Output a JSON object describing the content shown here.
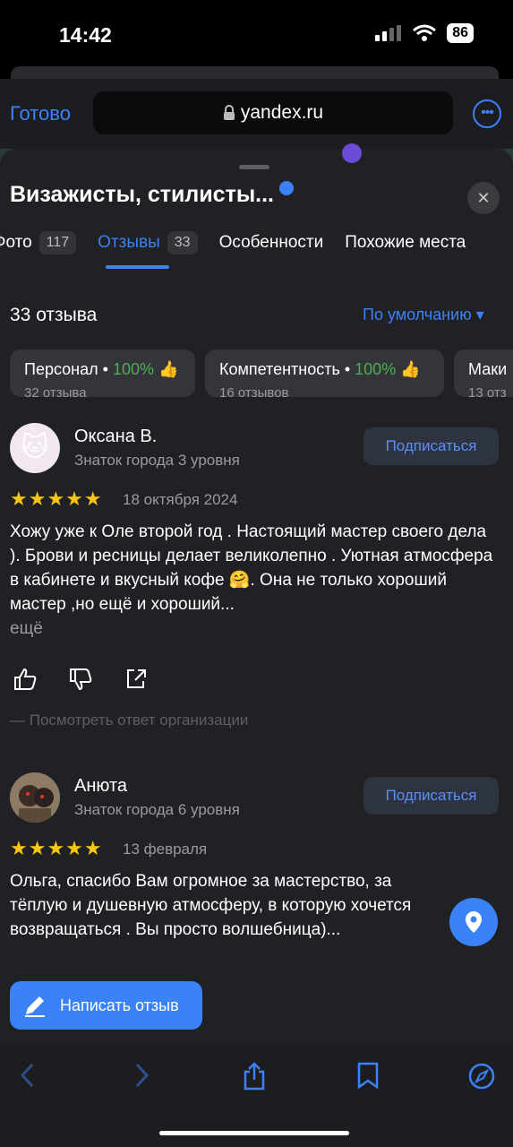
{
  "status": {
    "time": "14:42",
    "battery": "86"
  },
  "browser": {
    "done_label": "Готово",
    "url": "yandex.ru"
  },
  "header": {
    "title": "Визажисты, стилисты..."
  },
  "tabs": [
    {
      "label": "Фото",
      "count": "117"
    },
    {
      "label": "Отзывы",
      "count": "33"
    },
    {
      "label": "Особенности"
    },
    {
      "label": "Похожие места"
    }
  ],
  "summary": {
    "count_label": "33 отзыва",
    "sort_label": "По умолчанию ▾"
  },
  "chips": [
    {
      "label": "Персонал",
      "percent": "100%",
      "sub": "32 отзыва"
    },
    {
      "label": "Компетентность",
      "percent": "100%",
      "sub": "16 отзывов"
    },
    {
      "label": "Маки",
      "sub": "13 отз"
    }
  ],
  "reviews": [
    {
      "author": "Оксана В.",
      "level": "Знаток города 3 уровня",
      "subscribe": "Подписаться",
      "stars": "★★★★★",
      "date": "18 октября 2024",
      "text": "Хожу уже к Оле второй год . Настоящий мастер своего дела ). Брови и ресницы делает великолепно . Уютная атмосфера в кабинете и вкусный кофе 🤗. Она не только хороший мастер ,но ещё и хороший...",
      "more": "ещё",
      "org_reply": "— Посмотреть ответ организации"
    },
    {
      "author": "Анюта",
      "level": "Знаток города 6 уровня",
      "subscribe": "Подписаться",
      "stars": "★★★★★",
      "date": "13 февраля",
      "text": "Ольга, спасибо Вам огромное за мастерство, за тёплую и душевную атмосферу, в которую хочется возвращаться . Вы просто волшебница)..."
    }
  ],
  "write_review": "Написать отзыв",
  "colors": {
    "accent": "#3b82f6",
    "star": "#f5c518",
    "positive": "#4caf50",
    "sheet_bg": "#202124"
  }
}
